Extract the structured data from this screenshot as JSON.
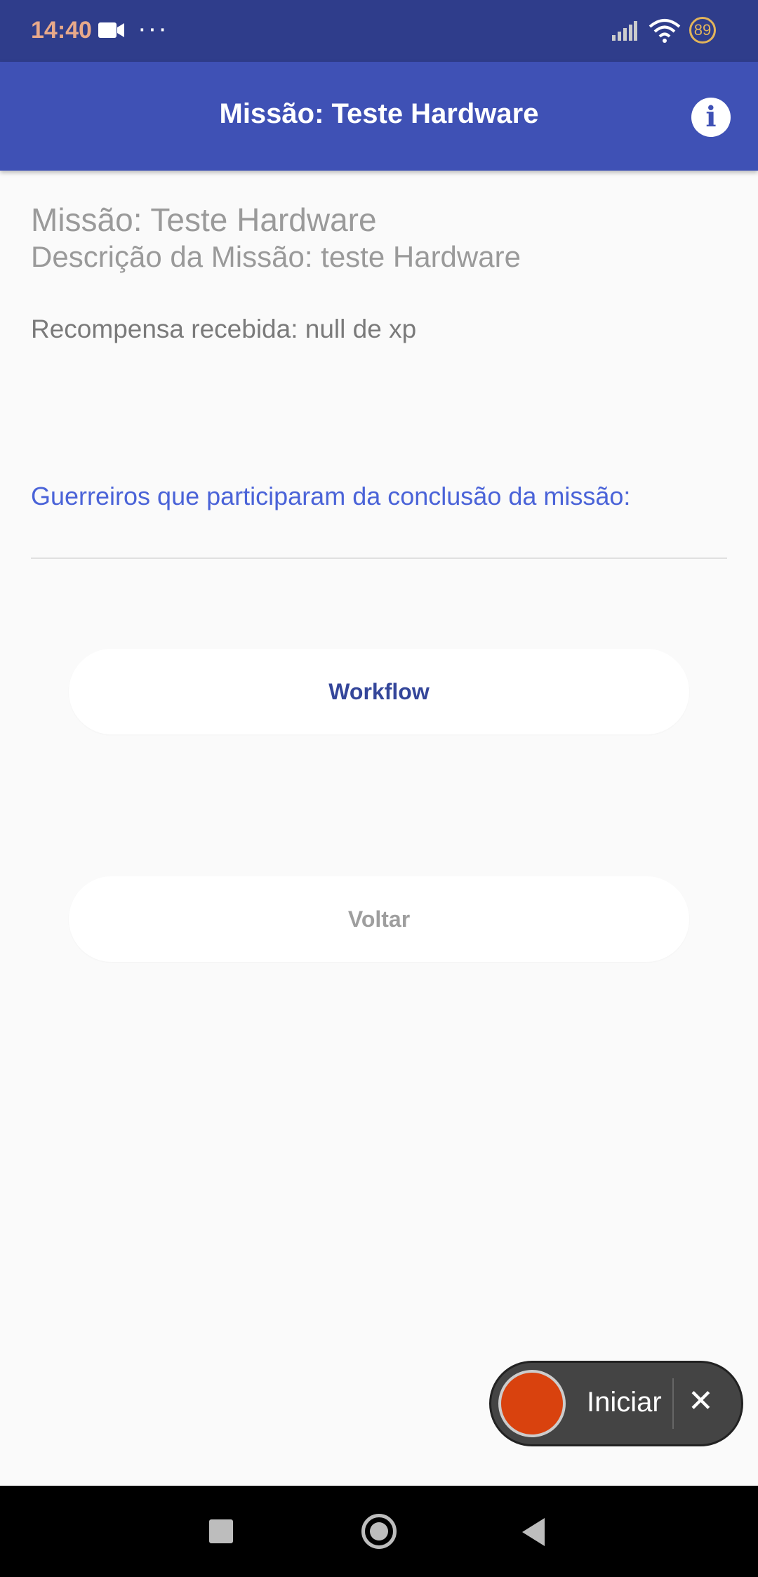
{
  "status": {
    "time": "14:40",
    "battery": "89",
    "icons": [
      "video-camera-icon",
      "more-dots-icon",
      "signal-icon",
      "wifi-icon",
      "battery-icon"
    ],
    "colors": {
      "time": "#e8a98a",
      "battery": "#e2b45a"
    }
  },
  "app_bar": {
    "title": "Missão: Teste Hardware",
    "info_icon": "info-icon",
    "color": "#3f51b5"
  },
  "mission": {
    "name": "Missão: Teste Hardware",
    "description": "Descrição da Missão: teste Hardware",
    "reward": "Recompensa recebida: null de xp",
    "warriors_label": "Guerreiros que participaram da conclusão da missão:"
  },
  "buttons": {
    "workflow": "Workflow",
    "voltar": "Voltar"
  },
  "recorder": {
    "label": "Iniciar",
    "close": "✕",
    "record_color": "#d9420e"
  },
  "nav": {
    "icons": [
      "recents-icon",
      "home-icon",
      "back-icon"
    ]
  }
}
